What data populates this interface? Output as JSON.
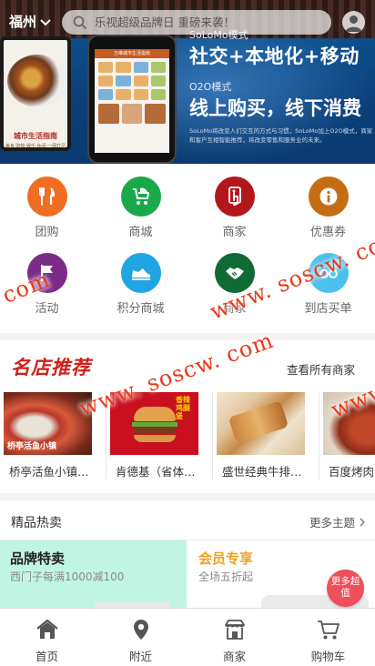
{
  "topbar": {
    "city": "福州",
    "search_placeholder": "乐视超级品牌日 重磅来袭！"
  },
  "banner": {
    "solomo_label": "SoLoMo模式",
    "headline_1": "社交+本地化+移动",
    "o2o_label": "O2O模式",
    "headline_2": "线上购买，线下消费",
    "description": "SoLoMo将改变人们交互的方式与习惯，SoLoMo加上O2O模式，商家和客户互相智能推荐，将改变零售和服务业的未来。",
    "phone_caption": "城市生活指南",
    "phone_caption_sub": "美食·购物·娱乐·休闲·一网打尽",
    "phone_screen_title": "万维城市生活指南"
  },
  "categories": [
    {
      "label": "团购",
      "icon": "fork-knife-icon",
      "color": "#f06d22"
    },
    {
      "label": "商城",
      "icon": "stroller-icon",
      "color": "#19a94a"
    },
    {
      "label": "商家",
      "icon": "tap-icon",
      "color": "#b3171b"
    },
    {
      "label": "优惠券",
      "icon": "info-icon",
      "color": "#c46d14"
    },
    {
      "label": "活动",
      "icon": "flag-icon",
      "color": "#7b2c86"
    },
    {
      "label": "积分商城",
      "icon": "sneaker-icon",
      "color": "#21a5e2"
    },
    {
      "label": "商家",
      "icon": "handshake-icon",
      "color": "#0f6b33"
    },
    {
      "label": "到店买单",
      "icon": "glasses-icon",
      "color": "#4cc0ec"
    }
  ],
  "recommend": {
    "title": "名店推荐",
    "more": "查看所有商家",
    "shops": [
      {
        "name": "桥亭活鱼小镇（...",
        "img_text": "桥亭活鱼小镇"
      },
      {
        "name": "肯德基（省体店）",
        "img_text": "香辣鸡腿堡"
      },
      {
        "name": "盛世经典牛排（...",
        "img_text": ""
      },
      {
        "name": "百度烤肉",
        "img_text": ""
      }
    ]
  },
  "hot": {
    "title": "精品热卖",
    "more": "更多主题",
    "card_left": {
      "title": "品牌特卖",
      "subtitle": "西门子每满1000减100"
    },
    "card_right": {
      "title": "会员专享",
      "subtitle": "全场五折起"
    },
    "bubble": "更多超值"
  },
  "tabs": [
    {
      "label": "首页",
      "icon": "home-icon"
    },
    {
      "label": "附近",
      "icon": "location-pin-icon"
    },
    {
      "label": "商家",
      "icon": "storefront-icon"
    },
    {
      "label": "购物车",
      "icon": "cart-icon"
    }
  ],
  "watermark": {
    "part_1": "com",
    "part_2": "www. soscw. com",
    "part_3": "www. soscw. com",
    "part_4": "www."
  },
  "colors": {
    "accent_red": "#d2201a",
    "member_orange": "#f0a020",
    "bubble_red": "#ee4f5a",
    "card_mint": "#bff5e2"
  }
}
